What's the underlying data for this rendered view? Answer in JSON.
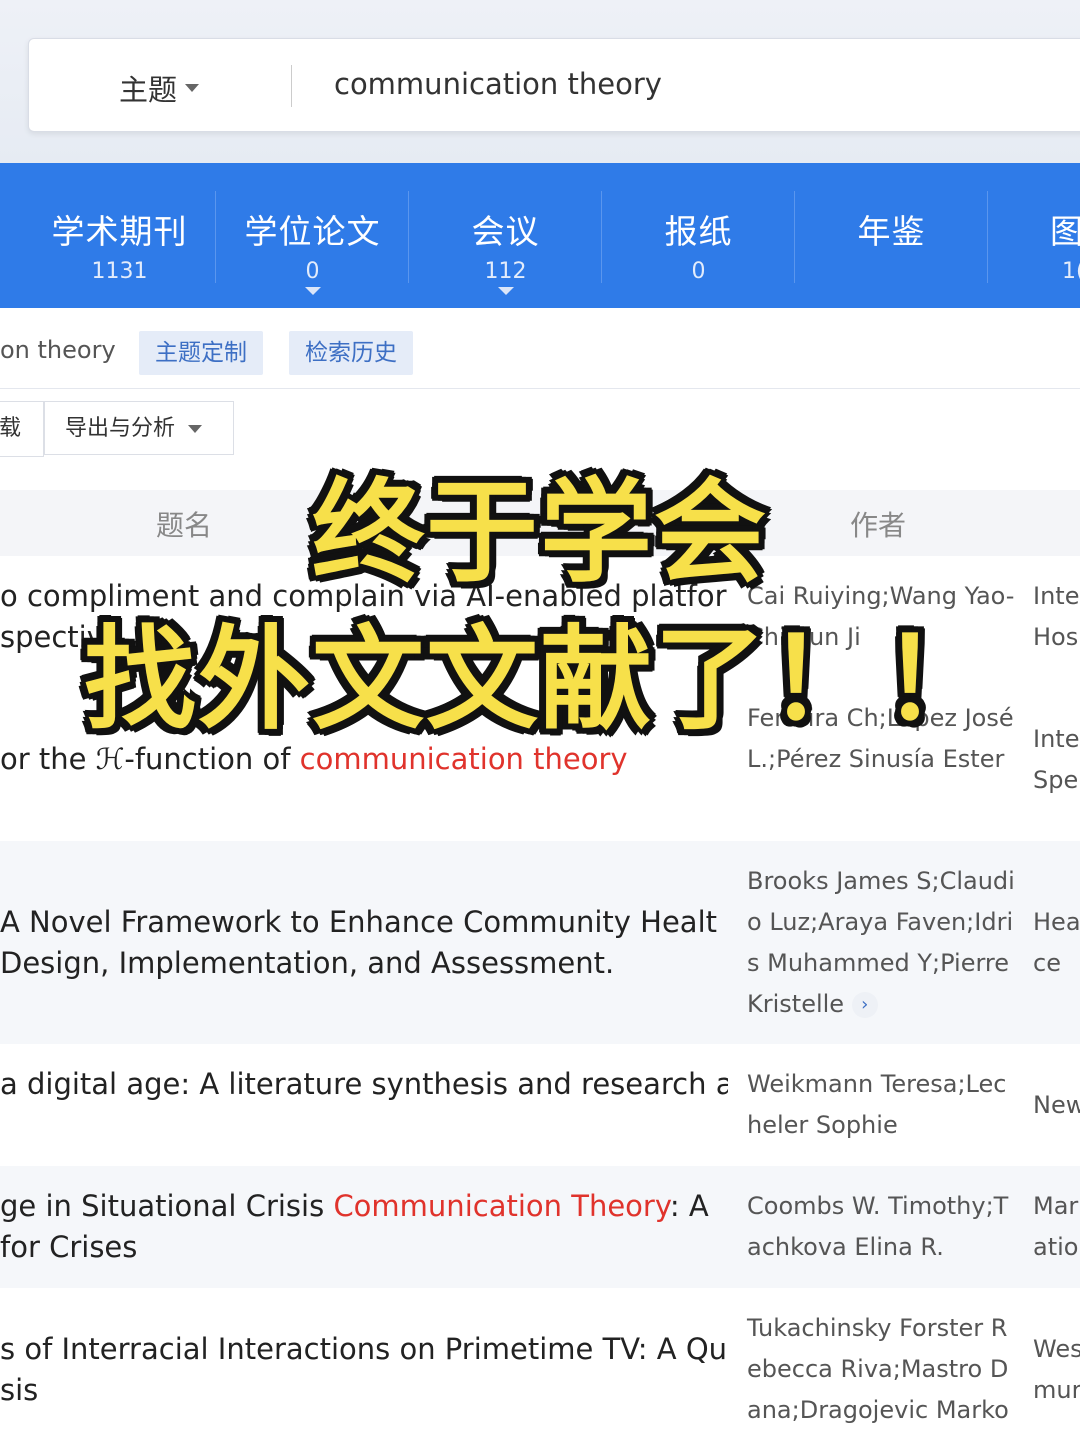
{
  "search": {
    "scope_label": "主题",
    "query": "communication theory"
  },
  "tabs": [
    {
      "label": "学术期刊",
      "count": "1131"
    },
    {
      "label": "学位论文",
      "count": "0"
    },
    {
      "label": "会议",
      "count": "112"
    },
    {
      "label": "报纸",
      "count": "0"
    },
    {
      "label": "年鉴",
      "count": ""
    },
    {
      "label": "图",
      "count": "1("
    }
  ],
  "toolbar": {
    "crumb": "on theory",
    "chip_customize": "主题定制",
    "chip_history": "检索历史",
    "btn_partial": "载",
    "btn_export": "导出与分析"
  },
  "table": {
    "col_title": "题名",
    "col_author": "作者",
    "rows": [
      {
        "title_lines": [
          [
            "o compliment and complain via AI-enabled platfor"
          ],
          [
            "spective"
          ]
        ],
        "authors": "Cai Ruiying;Wang Yao-Chi;Sun Ji",
        "source": "Inte\nHos"
      },
      {
        "title_lines": [
          [
            "or the ℋ-function of ",
            "communication theory"
          ]
        ],
        "authors": "Ferreira Ch;López José L.;Pérez Sinusía Ester",
        "source": "Inte\nSpe"
      },
      {
        "title_lines": [
          [
            "A Novel Framework to Enhance Community Healt"
          ],
          [
            "Design, Implementation, and Assessment."
          ]
        ],
        "authors": "Brooks James S;Claudio Luz;Araya Faven;Idris Muhammed Y;Pierre Kristelle",
        "more": "›",
        "source": "Hea\nce"
      },
      {
        "title_lines": [
          [
            "a digital age: A literature synthesis and research a"
          ]
        ],
        "authors": "Weikmann Teresa;Lecheler Sophie",
        "source": "New"
      },
      {
        "title_lines": [
          [
            "ge in Situational Crisis ",
            "Communication Theory",
            ": A"
          ],
          [
            "for Crises"
          ]
        ],
        "authors": "Coombs W. Timothy;Tachkova Elina R.",
        "source": "Mar\nation"
      },
      {
        "title_lines": [
          [
            "s of Interracial Interactions on Primetime TV: A Qu"
          ],
          [
            "sis"
          ]
        ],
        "authors": "Tukachinsky Forster Rebecca Riva;Mastro Dana;Dragojevic Marko",
        "source": "Wes\nmur"
      }
    ]
  },
  "overlay": {
    "line1": "终于学会",
    "line2": "找外文文献了！！"
  }
}
